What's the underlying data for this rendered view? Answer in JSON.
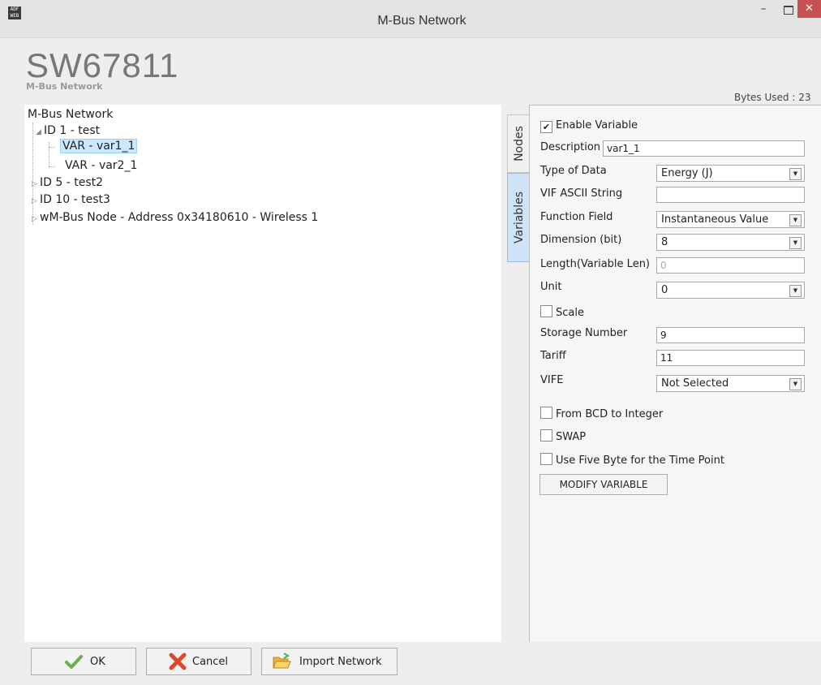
{
  "window": {
    "title": "M-Bus Network",
    "icon_text": "ADFWEB",
    "minimize_label": "–",
    "close_label": "✕"
  },
  "header": {
    "product": "SW67811",
    "subtitle": "M-Bus Network",
    "bytes_used": "Bytes Used : 23"
  },
  "tree": {
    "root": "M-Bus Network",
    "items": [
      {
        "label": "ID 1 - test",
        "expanded": true
      },
      {
        "label": "VAR - var1_1",
        "selected": true
      },
      {
        "label": "VAR - var2_1"
      },
      {
        "label": "ID 5 - test2",
        "expanded": false
      },
      {
        "label": "ID 10 - test3",
        "expanded": false
      },
      {
        "label": "wM-Bus Node - Address 0x34180610 - Wireless 1",
        "expanded": false
      }
    ]
  },
  "tabs": [
    {
      "label": "Nodes",
      "active": false
    },
    {
      "label": "Variables",
      "active": true
    }
  ],
  "form": {
    "enable_variable": {
      "label": "Enable Variable",
      "checked": true
    },
    "description": {
      "label": "Description",
      "value": "var1_1"
    },
    "type_of_data": {
      "label": "Type of Data",
      "value": "Energy (J)"
    },
    "vif_ascii": {
      "label": "VIF ASCII String",
      "value": ""
    },
    "function_field": {
      "label": "Function Field",
      "value": "Instantaneous Value"
    },
    "dimension": {
      "label": "Dimension (bit)",
      "value": "8"
    },
    "length": {
      "label": "Length(Variable Len)",
      "value": "0"
    },
    "unit": {
      "label": "Unit",
      "value": "0"
    },
    "scale": {
      "label": "Scale",
      "checked": false
    },
    "storage_number": {
      "label": "Storage Number",
      "value": "9"
    },
    "tariff": {
      "label": "Tariff",
      "value": "11"
    },
    "vife": {
      "label": "VIFE",
      "value": "Not Selected"
    },
    "bcd": {
      "label": "From BCD to Integer",
      "checked": false
    },
    "swap": {
      "label": "SWAP",
      "checked": false
    },
    "five_byte": {
      "label": "Use Five Byte for the Time Point",
      "checked": false
    },
    "modify_button": "MODIFY VARIABLE"
  },
  "buttons": {
    "ok": "OK",
    "cancel": "Cancel",
    "import": "Import Network"
  },
  "colors": {
    "selection": "#cce8ff",
    "active_tab": "#cfe3f7",
    "close": "#c75050"
  }
}
